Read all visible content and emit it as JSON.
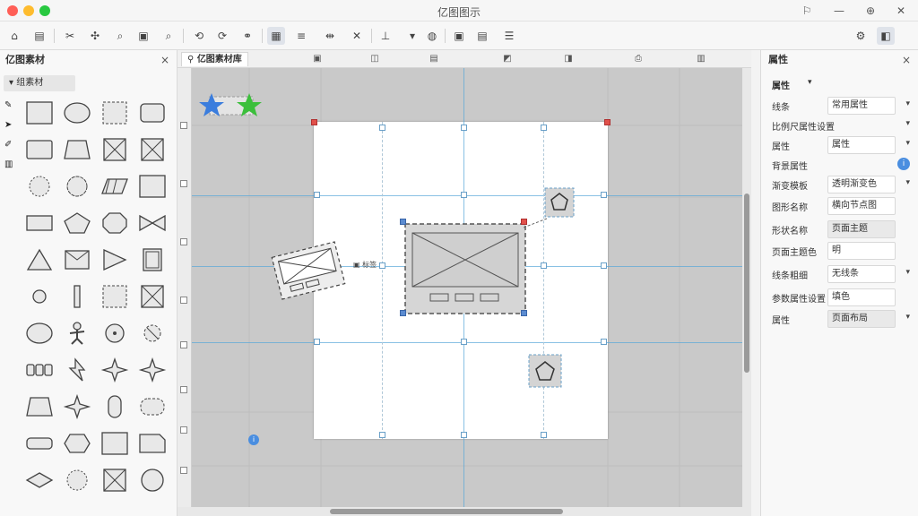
{
  "window": {
    "title": "亿图图示",
    "controls": [
      "close",
      "minimize",
      "maximize"
    ],
    "control_colors": {
      "close": "#ff5f57",
      "minimize": "#febc2e",
      "maximize": "#28c840"
    }
  },
  "toolbar": {
    "icons": [
      "home-icon",
      "file-icon",
      "cut-icon",
      "paste-icon",
      "search-icon",
      "export-icon",
      "zoom-icon",
      "undo-icon",
      "redo-icon",
      "connect-icon",
      "page-icon",
      "align-icon",
      "distribute-icon",
      "swap-icon",
      "rotate-icon",
      "more-icon",
      "theme-icon",
      "insert-icon",
      "layout-icon",
      "list-icon",
      "settings-icon",
      "panel-toggle-icon"
    ]
  },
  "left_panel": {
    "title": "亿图素材",
    "close": "×",
    "library_label": "组素材"
  },
  "canvas": {
    "tab_label": "亿图素材库",
    "star_colors": {
      "blue": "#3b7ddd",
      "green": "#3cbf3c"
    },
    "label_text": "标签",
    "info_badge": "i"
  },
  "right_panel": {
    "title": "属性",
    "close": "×",
    "section_label": "属性",
    "rows": [
      {
        "label": "线条",
        "value": "常用属性"
      },
      {
        "label": "比例尺属性设置",
        "value": ""
      },
      {
        "label": "属性",
        "value": "属性"
      },
      {
        "label": "背景属性",
        "value": ""
      },
      {
        "label": "渐变模板",
        "value": "透明渐变色"
      },
      {
        "label": "图形名称",
        "value": "横向节点图"
      },
      {
        "label": "形状名称",
        "value": "页面主题"
      },
      {
        "label": "页面主题色",
        "value": "明"
      },
      {
        "label": "线条粗细",
        "value": "无线条"
      },
      {
        "label": "参数属性设置",
        "value": "填色"
      },
      {
        "label": "属性",
        "value": "页面布局"
      }
    ]
  }
}
